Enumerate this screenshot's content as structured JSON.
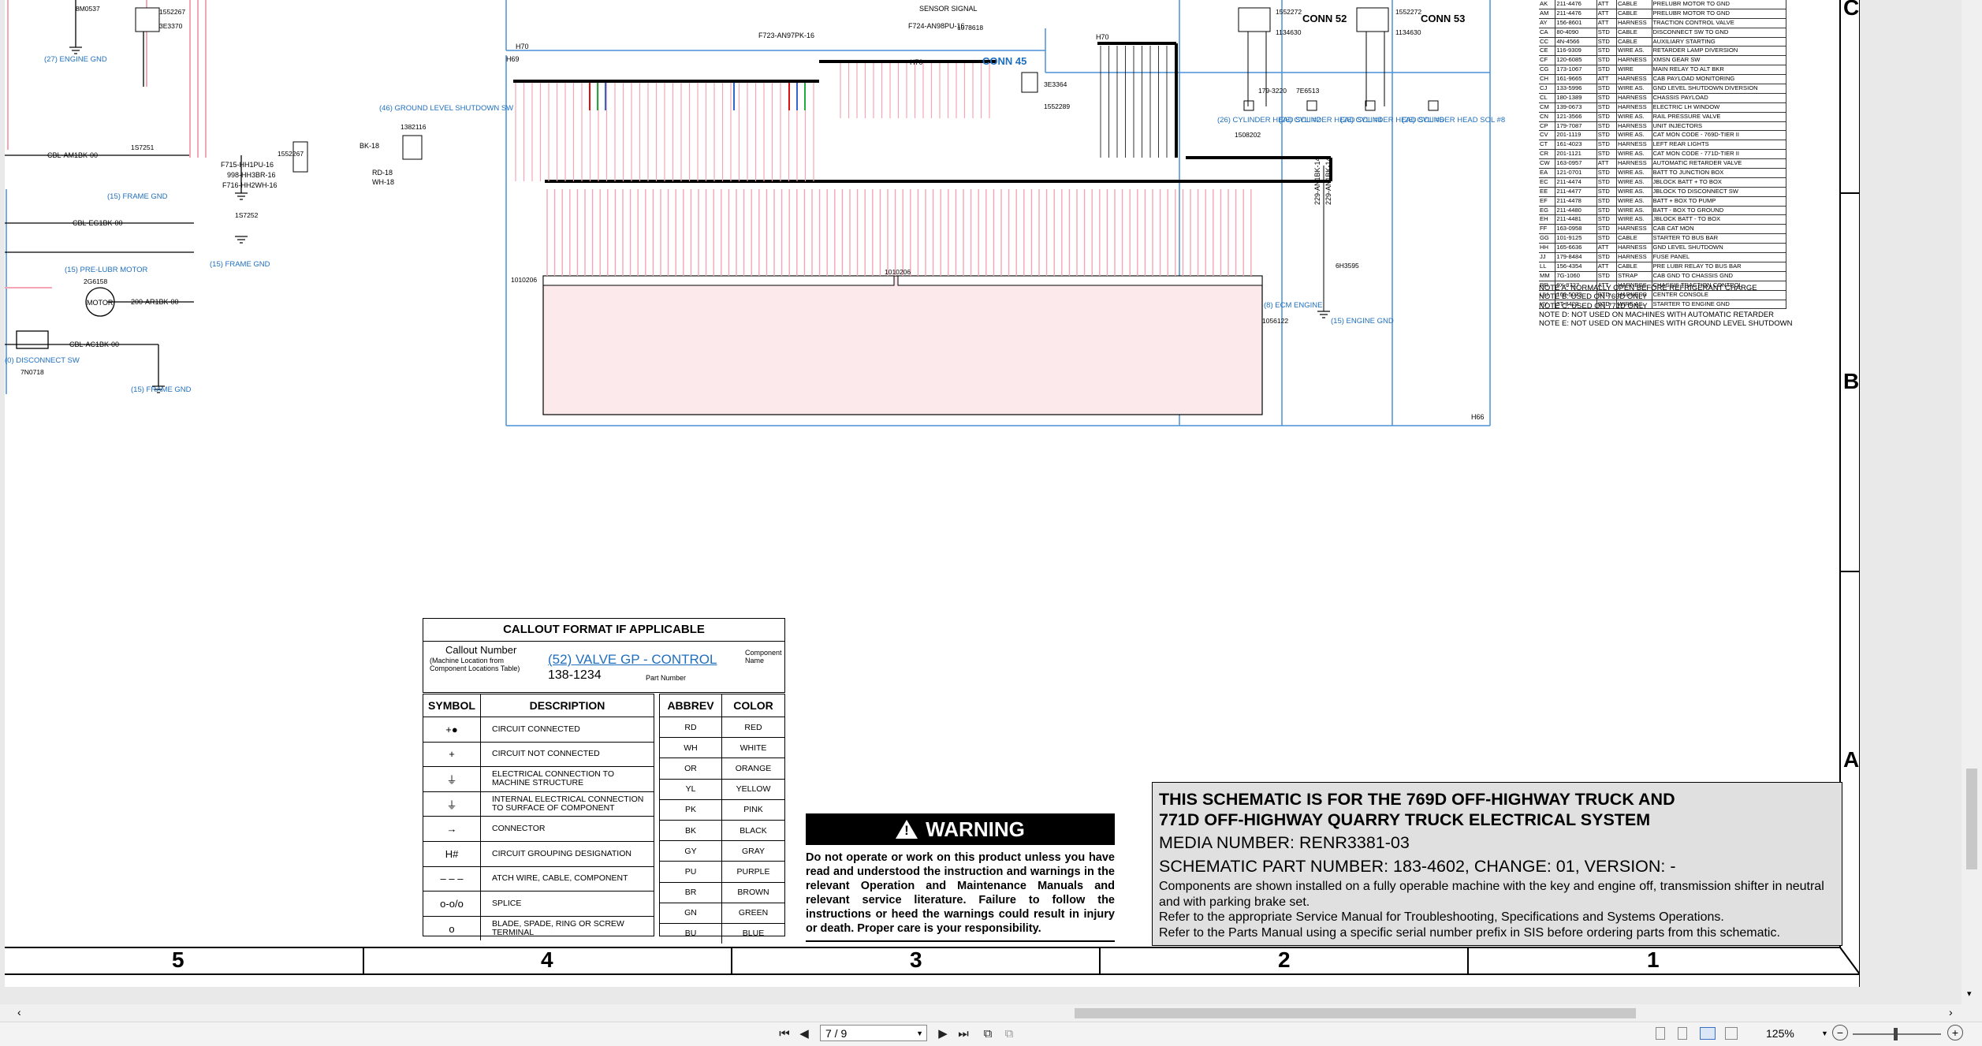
{
  "frame": {
    "columns": [
      "5",
      "4",
      "3",
      "2",
      "1"
    ],
    "rows": [
      "C",
      "B",
      "A"
    ]
  },
  "schematic": {
    "connectors": [
      "CONN 45",
      "CONN 52",
      "CONN 53"
    ],
    "harness": [
      "H70",
      "H69",
      "H70",
      "H70",
      "H66"
    ],
    "left_labels": [
      "(27) ENGINE GND",
      "(15) FRAME GND",
      "(15) FRAME GND",
      "(15) PRE-LUBR MOTOR",
      "(15) FRAME GND",
      "(0) DISCONNECT SW",
      "(46) GROUND LEVEL SHUTDOWN SW",
      "(15) ENGINE GND",
      "(8) ECM ENGINE",
      "(26) CYLINDER HEAD SOL #2",
      "(26) CYLINDER HEAD SOL #4",
      "(26) CYLINDER HEAD SOL #6",
      "(26) CYLINDER HEAD SOL #8"
    ],
    "parts": [
      "8M0537",
      "1552267",
      "3E3370",
      "1552267",
      "1S7251",
      "1S7252",
      "2G6158",
      "7N0718",
      "1382116",
      "6H3595",
      "1056122",
      "1010206",
      "1010206",
      "1078618",
      "3E3364",
      "1552289",
      "1552272",
      "1134630",
      "1552272",
      "1134630",
      "1508202",
      "7E6513",
      "179-3220"
    ],
    "wires": [
      "CBL-AM1BK-00",
      "CBL-EG1BK-00",
      "CBL-AC1BK-00",
      "200-AR1BK-00",
      "F715-HH1PU-16",
      "998-HH3BR-16",
      "F716-HH2WH-16",
      "BK-18",
      "RD-18",
      "WH-18",
      "F724-AN98PU-16",
      "F723-AN97PK-16",
      "229-AN1BK-14",
      "229-AN1BK-14"
    ],
    "motor_label": "MOTOR",
    "signal_label": "SENSOR SIGNAL"
  },
  "callout": {
    "title": "CALLOUT FORMAT IF APPLICABLE",
    "callout_number": "Callout Number",
    "callout_sub": "(Machine Location from Component Locations Table)",
    "example_link": "(52) VALVE GP - CONTROL",
    "component_name": "Component Name",
    "part_example": "138-1234",
    "part_number_label": "Part Number"
  },
  "symbols": {
    "headers": [
      "SYMBOL",
      "DESCRIPTION"
    ],
    "rows": [
      {
        "glyph": "+●",
        "desc": "CIRCUIT CONNECTED"
      },
      {
        "glyph": "+",
        "desc": "CIRCUIT NOT CONNECTED"
      },
      {
        "glyph": "⏚",
        "desc": "ELECTRICAL CONNECTION TO MACHINE STRUCTURE"
      },
      {
        "glyph": "⏚",
        "desc": "INTERNAL ELECTRICAL CONNECTION TO SURFACE OF COMPONENT"
      },
      {
        "glyph": "→",
        "desc": "CONNECTOR"
      },
      {
        "glyph": "H#",
        "desc": "CIRCUIT GROUPING DESIGNATION"
      },
      {
        "glyph": "– – –",
        "desc": "ATCH WIRE, CABLE, COMPONENT"
      },
      {
        "glyph": "o-o/o",
        "desc": "SPLICE"
      },
      {
        "glyph": "o",
        "desc": "BLADE, SPADE, RING OR SCREW TERMINAL"
      }
    ]
  },
  "abbrev": {
    "headers": [
      "ABBREV",
      "COLOR"
    ],
    "rows": [
      [
        "RD",
        "RED"
      ],
      [
        "WH",
        "WHITE"
      ],
      [
        "OR",
        "ORANGE"
      ],
      [
        "YL",
        "YELLOW"
      ],
      [
        "PK",
        "PINK"
      ],
      [
        "BK",
        "BLACK"
      ],
      [
        "GY",
        "GRAY"
      ],
      [
        "PU",
        "PURPLE"
      ],
      [
        "BR",
        "BROWN"
      ],
      [
        "GN",
        "GREEN"
      ],
      [
        "BU",
        "BLUE"
      ]
    ]
  },
  "warning": {
    "title": "WARNING",
    "body": "Do not operate or work on this product unless you have read and understood the instruction and warnings in the relevant Operation and Maintenance Manuals and relevant service literature. Failure to follow the instructions or heed the warnings could result in injury or death. Proper care is your responsibility."
  },
  "title_block": {
    "line1": "THIS SCHEMATIC IS FOR THE 769D OFF-HIGHWAY TRUCK AND",
    "line2": "771D OFF-HIGHWAY QUARRY TRUCK ELECTRICAL SYSTEM",
    "media": "MEDIA NUMBER: RENR3381-03",
    "part": "SCHEMATIC PART NUMBER: 183-4602, CHANGE: 01, VERSION: -",
    "note1": "Components are shown installed on a fully operable machine with the key and engine off, transmission shifter in neutral and with parking brake set.",
    "note2": "Refer to the appropriate Service Manual for Troubleshooting, Specifications and Systems Operations.",
    "note3": "Refer to the Parts Manual using a specific serial number prefix in SIS before ordering parts from this schematic."
  },
  "harness_legend": {
    "rows": [
      [
        "AK",
        "211-4476",
        "ATT",
        "CABLE",
        "PRELUBR MOTOR TO GND"
      ],
      [
        "AM",
        "211-4476",
        "ATT",
        "CABLE",
        "PRELUBR MOTOR TO GND"
      ],
      [
        "AY",
        "156-8601",
        "ATT",
        "HARNESS",
        "TRACTION CONTROL VALVE"
      ],
      [
        "CA",
        "80-4090",
        "STD",
        "CABLE",
        "DISCONNECT SW TO GND"
      ],
      [
        "CC",
        "4N-4566",
        "STD",
        "CABLE",
        "AUXILIARY STARTING"
      ],
      [
        "CE",
        "116-9309",
        "STD",
        "WIRE AS.",
        "RETARDER LAMP DIVERSION"
      ],
      [
        "CF",
        "120-6085",
        "STD",
        "HARNESS",
        "XMSN GEAR SW"
      ],
      [
        "CG",
        "173-1067",
        "STD",
        "WIRE",
        "MAIN RELAY TO ALT BKR"
      ],
      [
        "CH",
        "161-9665",
        "ATT",
        "HARNESS",
        "CAB PAYLOAD MONITORING"
      ],
      [
        "CJ",
        "133-5996",
        "STD",
        "WIRE AS.",
        "GND LEVEL SHUTDOWN DIVERSION"
      ],
      [
        "CL",
        "180-1389",
        "STD",
        "HARNESS",
        "CHASSIS PAYLOAD"
      ],
      [
        "CM",
        "139-0673",
        "STD",
        "HARNESS",
        "ELECTRIC LH WINDOW"
      ],
      [
        "CN",
        "121-3566",
        "STD",
        "WIRE AS.",
        "RAIL PRESSURE VALVE"
      ],
      [
        "CP",
        "179-7087",
        "STD",
        "HARNESS",
        "UNIT INJECTORS"
      ],
      [
        "CV",
        "201-1119",
        "STD",
        "WIRE AS.",
        "CAT MON CODE - 769D-TIER II"
      ],
      [
        "CT",
        "161-4023",
        "STD",
        "HARNESS",
        "LEFT REAR LIGHTS"
      ],
      [
        "CR",
        "201-1121",
        "STD",
        "WIRE AS.",
        "CAT MON CODE - 771D-TIER II"
      ],
      [
        "CW",
        "163-0957",
        "ATT",
        "HARNESS",
        "AUTOMATIC RETARDER VALVE"
      ],
      [
        "EA",
        "121-0701",
        "STD",
        "WIRE AS.",
        "BATT TO JUNCTION BOX"
      ],
      [
        "EC",
        "211-4474",
        "STD",
        "WIRE AS.",
        "JBLOCK BATT + TO BOX"
      ],
      [
        "EE",
        "211-4477",
        "STD",
        "WIRE AS.",
        "JBLOCK TO DISCONNECT SW"
      ],
      [
        "EF",
        "211-4478",
        "STD",
        "WIRE AS.",
        "BATT + BOX TO PUMP"
      ],
      [
        "EG",
        "211-4480",
        "STD",
        "WIRE AS.",
        "BATT - BOX TO GROUND"
      ],
      [
        "EH",
        "211-4481",
        "STD",
        "WIRE AS.",
        "JBLOCK BATT - TO BOX"
      ],
      [
        "FF",
        "163-0958",
        "STD",
        "HARNESS",
        "CAB CAT MON"
      ],
      [
        "GG",
        "101-9125",
        "STD",
        "CABLE",
        "STARTER TO BUS BAR"
      ],
      [
        "HH",
        "165-6636",
        "ATT",
        "HARNESS",
        "GND LEVEL SHUTDOWN"
      ],
      [
        "JJ",
        "179-8484",
        "STD",
        "HARNESS",
        "FUSE PANEL"
      ],
      [
        "LL",
        "156-4354",
        "ATT",
        "CABLE",
        "PRE LUBR RELAY TO BUS BAR"
      ],
      [
        "MM",
        "7G-1060",
        "STD",
        "STRAP",
        "CAB GND TO CHASSIS GND"
      ],
      [
        "RR",
        "9X-8727",
        "ATT",
        "HARNESS",
        "CHASSIS TRACTION CONTROL"
      ],
      [
        "UU",
        "160-5073",
        "STD",
        "HARNESS",
        "CENTER CONSOLE"
      ],
      [
        "YY",
        "3T-3422",
        "STD",
        "WIRE AS.",
        "STARTER TO ENGINE GND"
      ]
    ],
    "notes": [
      "NOTE A: NORMALLY OPEN BEFORE REFRIGERANT CHARGE",
      "NOTE B: USED ON 769D ONLY",
      "NOTE C: USED ON 771D ONLY",
      "NOTE D: NOT USED ON MACHINES WITH AUTOMATIC RETARDER",
      "NOTE E: NOT USED ON MACHINES WITH GROUND LEVEL SHUTDOWN"
    ]
  },
  "viewer": {
    "page_value": "7 / 9",
    "zoom": "125%",
    "icons": [
      "first-page-icon",
      "prev-page-icon",
      "next-page-icon",
      "last-page-icon",
      "prev-view-icon",
      "next-view-icon",
      "zoom-out-icon",
      "zoom-in-icon"
    ]
  },
  "colors": {
    "link": "#1f6fbf",
    "wire_pink": "#f4a6b4",
    "wire_blue": "#4a90d9",
    "title_bg": "#e0e0e0",
    "warning_bg": "#000000"
  }
}
